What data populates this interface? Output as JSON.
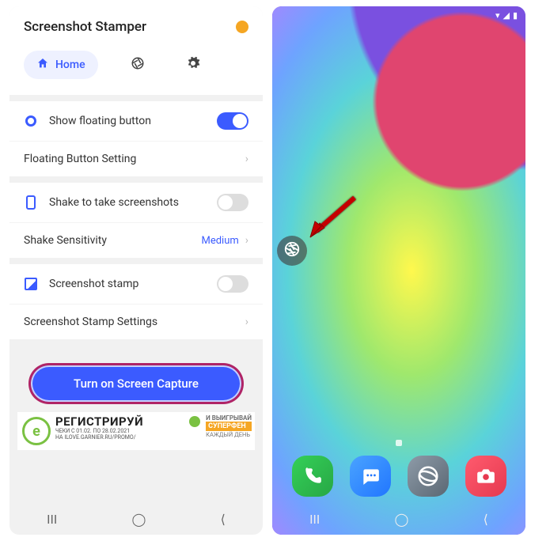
{
  "app": {
    "title": "Screenshot Stamper",
    "tabs": {
      "home": "Home"
    }
  },
  "settings": {
    "floating": {
      "label": "Show floating button",
      "on": true,
      "sub": "Floating Button Setting"
    },
    "shake": {
      "label": "Shake to take screenshots",
      "on": false,
      "sub": "Shake Sensitivity",
      "value": "Medium"
    },
    "stamp": {
      "label": "Screenshot stamp",
      "on": false,
      "sub": "Screenshot Stamp Settings"
    }
  },
  "cta": "Turn on Screen Capture",
  "ad": {
    "main": "РЕГИСТРИРУЙ",
    "sub1": "ЧЕКИ С 01.02. ПО 28.02.2021",
    "sub2": "НА ILOVE.GARNIER.RU/PROMO/",
    "r1": "И ВЫИГРЫВАЙ",
    "r2": "СУПЕРФЕН",
    "r3": "КАЖДЫЙ ДЕНЬ"
  },
  "nav": {
    "recent": "III",
    "home": "◯",
    "back": "⟨"
  },
  "homescreen": {
    "dock": [
      "phone",
      "messages",
      "browser",
      "camera"
    ]
  }
}
